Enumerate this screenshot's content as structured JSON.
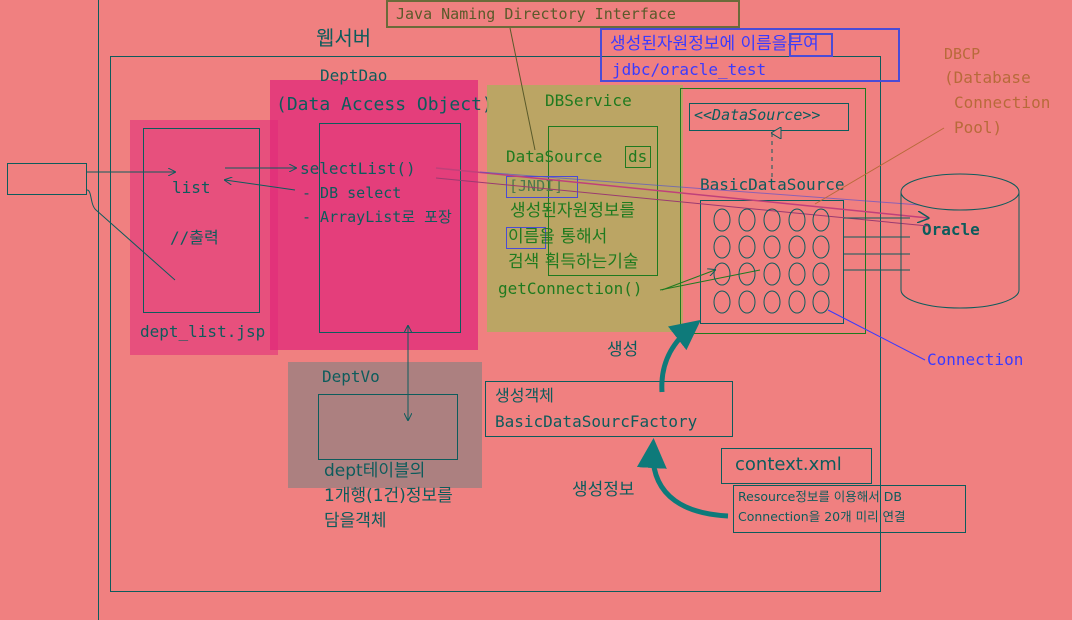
{
  "labels": {
    "jndi_title": "Java Naming Directory Interface",
    "webserver": "웹서버",
    "naming_note_line1": "생성된자원정보에 이름을부여",
    "naming_note_line2": "jdbc/oracle_test",
    "dbcp_line1": "DBCP",
    "dbcp_line2": "(Database",
    "dbcp_line3": "Connection",
    "dbcp_line4": "Pool)",
    "deptdao": "DeptDao",
    "deptdao_sub": "(Data Access Object)",
    "dbservice": "DBService",
    "datasource_iface": "<<DataSource>>",
    "datasource": "DataSource",
    "ds": "ds",
    "jndi_tag": "[JNDI]",
    "jndi_desc_line1": "생성된자원정보를",
    "jndi_desc_line2": "이름을 통해서",
    "jndi_desc_line3": "검색 획득하는기술",
    "getconnection": "getConnection()",
    "basicdatasource": "BasicDataSource",
    "oracle": "Oracle",
    "connection": "Connection",
    "list": "list",
    "print_comment": "//출력",
    "dept_list_jsp": "dept_list.jsp",
    "selectlist": "selectList()",
    "db_select": "- DB select",
    "arraylist_wrap": "- ArrayList로 포장",
    "deptvo": "DeptVo",
    "deptvo_desc_line1": "dept테이블의",
    "deptvo_desc_line2": "1개행(1건)정보를",
    "deptvo_desc_line3": "담을객체",
    "create": "생성",
    "factory_line1": "생성객체",
    "factory_line2": "BasicDataSourcFactory",
    "create_info": "생성정보",
    "context_xml": "context.xml",
    "resource_line1": "Resource정보를 이용해서 DB",
    "resource_line2": "Connection을 20개 미리 연결"
  },
  "colors": {
    "background": "#f08080",
    "teal": "#0d5c5c",
    "magenta": "#e0287a",
    "olive": "#b5a860",
    "grey_box": "#a88080",
    "blue": "#3a3aff",
    "green": "#1f7a1f",
    "orange": "#b86a3a"
  }
}
